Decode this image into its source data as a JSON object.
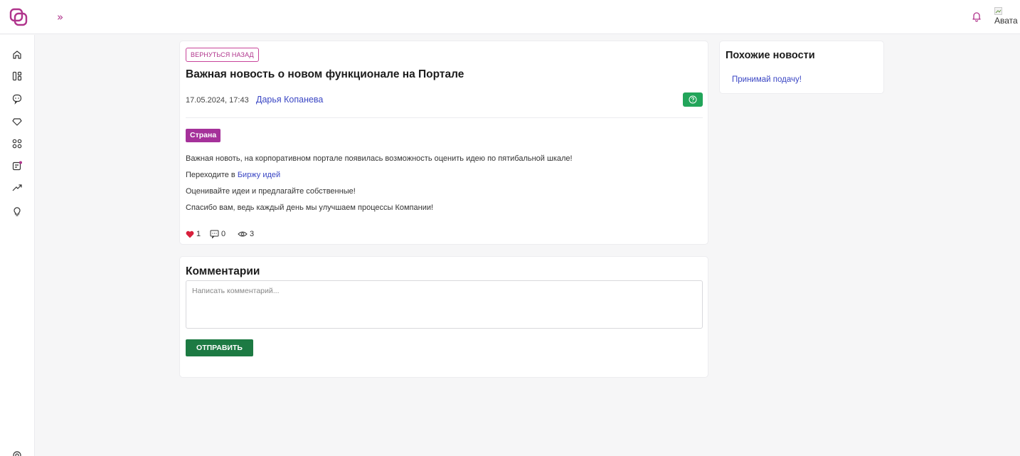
{
  "header": {
    "expand_label": "»",
    "avatar_alt": "Авата"
  },
  "sidebar": {
    "items": [
      {
        "icon": "home-icon"
      },
      {
        "icon": "dashboard-icon"
      },
      {
        "icon": "chat-icon"
      },
      {
        "icon": "diamond-icon"
      },
      {
        "icon": "apps-grid-icon"
      },
      {
        "icon": "news-icon"
      },
      {
        "icon": "trend-up-icon"
      },
      {
        "icon": "lightbulb-icon"
      }
    ]
  },
  "news": {
    "back_label": "ВЕРНУТЬСЯ НАЗАД",
    "title": "Важная новость о новом функционале на Портале",
    "date": "17.05.2024, 17:43",
    "author": "Дарья Копанева",
    "tag": "Страна",
    "body": {
      "line1": "Важная новоть, на корпоративном портале появилась возможность оценить идею по пятибальной шкале!",
      "line2_prefix": "Переходите в ",
      "line2_link": "Биржу идей",
      "line3": "Оценивайте идеи  и предлагайте собственные!",
      "line4": "Спасибо вам, ведь каждый день мы улучшаем процессы Компании!"
    },
    "stats": {
      "likes": "1",
      "comments": "0",
      "views": "3"
    }
  },
  "comments": {
    "title": "Комментарии",
    "placeholder": "Написать комментарий...",
    "send_label": "ОТПРАВИТЬ"
  },
  "similar": {
    "title": "Похожие новости",
    "items": [
      "Принимай подачу!"
    ]
  },
  "colors": {
    "accent": "#b0348c",
    "link": "#3a46c4",
    "tag": "#a5319a",
    "send": "#1d7a43",
    "help": "#22a55a",
    "like": "#d8203c"
  }
}
